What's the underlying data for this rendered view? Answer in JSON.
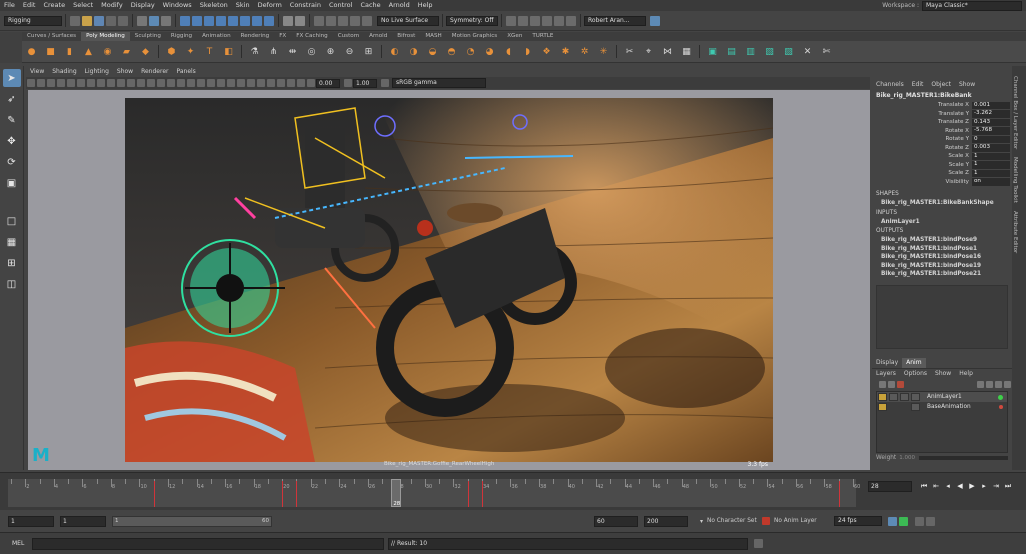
{
  "menubar": {
    "items": [
      "File",
      "Edit",
      "Create",
      "Select",
      "Modify",
      "Display",
      "Windows",
      "Skeleton",
      "Skin",
      "Deform",
      "Constrain",
      "Control",
      "Cache",
      "Arnold",
      "Help"
    ],
    "workspace_label": "Workspace :",
    "workspace_value": "Maya Classic*"
  },
  "statusline": {
    "menuset": "Rigging",
    "live_surface": "No Live Surface",
    "symmetry": "Symmetry: Off",
    "user": "Robert Aran..."
  },
  "shelf": {
    "tabs": [
      "Curves / Surfaces",
      "Poly Modeling",
      "Sculpting",
      "Rigging",
      "Animation",
      "Rendering",
      "FX",
      "FX Caching",
      "Custom",
      "Arnold",
      "Bifrost",
      "MASH",
      "Motion Graphics",
      "XGen",
      "TURTLE"
    ],
    "active_tab": "Poly Modeling"
  },
  "viewport": {
    "menu": [
      "View",
      "Shading",
      "Lighting",
      "Show",
      "Renderer",
      "Panels"
    ],
    "near_value": "0.00",
    "far_value": "1.00",
    "color_space": "sRGB gamma",
    "camera_label": "Bike_rig_MASTER:Goffie_RearWheelHigh",
    "fps": "3.3 fps",
    "logo": "M"
  },
  "channelbox": {
    "tabs": [
      "Channels",
      "Edit",
      "Object",
      "Show"
    ],
    "object_name": "Bike_rig_MASTER1:BikeBank",
    "attributes": [
      {
        "name": "Translate X",
        "value": "0.001"
      },
      {
        "name": "Translate Y",
        "value": "-3.262"
      },
      {
        "name": "Translate Z",
        "value": "0.143"
      },
      {
        "name": "Rotate X",
        "value": "-5.768"
      },
      {
        "name": "Rotate Y",
        "value": "0"
      },
      {
        "name": "Rotate Z",
        "value": "0.003"
      },
      {
        "name": "Scale X",
        "value": "1"
      },
      {
        "name": "Scale Y",
        "value": "1"
      },
      {
        "name": "Scale Z",
        "value": "1"
      },
      {
        "name": "Visibility",
        "value": "on"
      }
    ],
    "shapes_header": "SHAPES",
    "shape_item": "Bike_rig_MASTER1:BikeBankShape",
    "inputs_header": "INPUTS",
    "input_item": "AnimLayer1",
    "outputs_header": "OUTPUTS",
    "outputs": [
      "Bike_rig_MASTER1:bindPose9",
      "Bike_rig_MASTER1:bindPose1",
      "Bike_rig_MASTER1:bindPose16",
      "Bike_rig_MASTER1:bindPose19",
      "Bike_rig_MASTER1:bindPose21"
    ],
    "side_tabs": [
      "Channel Box / Layer Editor",
      "Modelling Toolkit",
      "Attribute Editor"
    ]
  },
  "layers": {
    "tabs": [
      "Display",
      "Anim"
    ],
    "menu": [
      "Layers",
      "Options",
      "Show",
      "Help"
    ],
    "rows": [
      "AnimLayer1",
      "BaseAnimation"
    ],
    "weight_label": "Weight",
    "weight_value": "1.000"
  },
  "timeslider": {
    "tick_labels": [
      "2",
      "4",
      "6",
      "8",
      "10",
      "12",
      "14",
      "16",
      "18",
      "20",
      "22",
      "24",
      "26",
      "28",
      "30",
      "32",
      "34",
      "36",
      "38",
      "40",
      "42",
      "44",
      "46",
      "48",
      "50",
      "52",
      "54",
      "56",
      "58",
      "60"
    ],
    "current_frame": "28",
    "current_frame_field": "28",
    "key_frames": [
      11,
      20,
      21,
      33,
      34,
      59
    ],
    "start": 1,
    "end": 60
  },
  "range": {
    "start_field": "1",
    "start_anim": "1",
    "range_start": "1",
    "range_end": "60",
    "end_field": "60",
    "anim_end": "200",
    "character_set": "No Character Set",
    "anim_layer": "No Anim Layer",
    "fps": "24 fps"
  },
  "cmdline": {
    "label": "MEL",
    "result": "// Result: 10"
  },
  "colors": {
    "accent": "#5d8ab5",
    "key_red": "#d0343a",
    "wheel_green": "#2fe0a0"
  }
}
